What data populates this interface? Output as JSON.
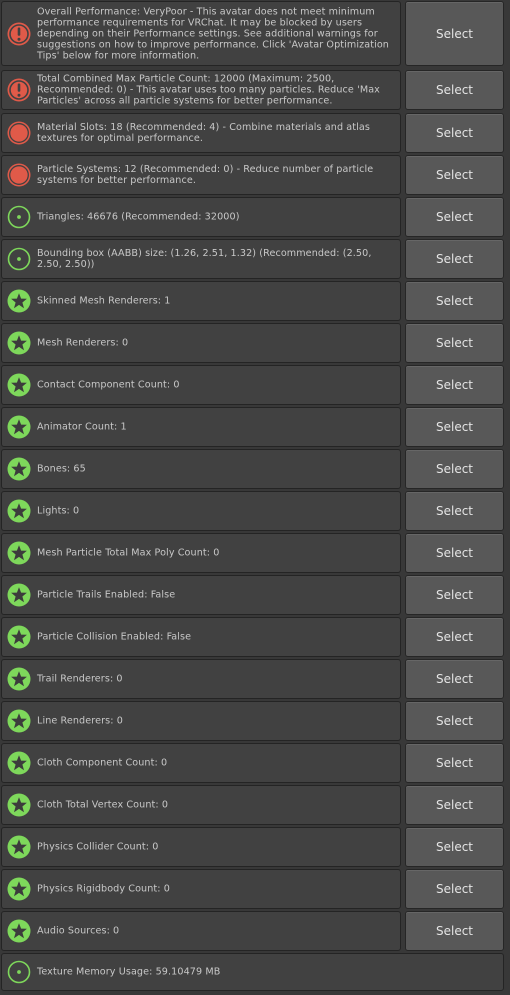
{
  "button_label": "Select",
  "colors": {
    "error": "#e05a49",
    "good": "#7ed85b",
    "info": "#7ed85b",
    "panel": "#414141",
    "button": "#585858",
    "background": "#383838"
  },
  "rows": [
    {
      "icon": "error-exclamation-icon",
      "status": "error",
      "text": "Overall Performance: VeryPoor - This avatar does not meet minimum performance requirements for VRChat. It may be blocked by users depending on their Performance settings. See additional warnings for suggestions on how to improve performance. Click 'Avatar Optimization Tips' below for more information.",
      "select": true
    },
    {
      "icon": "error-exclamation-icon",
      "status": "error",
      "text": "Total Combined Max Particle Count: 12000 (Maximum: 2500, Recommended: 0) - This avatar uses too many particles. Reduce 'Max Particles' across all particle systems for better performance.",
      "select": true
    },
    {
      "icon": "error-circle-icon",
      "status": "error",
      "text": "Material Slots: 18 (Recommended: 4) - Combine materials and atlas textures for optimal performance.",
      "select": true
    },
    {
      "icon": "error-circle-icon",
      "status": "error",
      "text": "Particle Systems: 12 (Recommended: 0) - Reduce number of particle systems for better performance.",
      "select": true
    },
    {
      "icon": "info-dot-icon",
      "status": "info",
      "text": "Triangles: 46676 (Recommended: 32000)",
      "select": true
    },
    {
      "icon": "info-dot-icon",
      "status": "info",
      "text": "Bounding box (AABB) size: (1.26, 2.51, 1.32) (Recommended: (2.50, 2.50, 2.50))",
      "select": true
    },
    {
      "icon": "star-icon",
      "status": "good",
      "text": "Skinned Mesh Renderers: 1",
      "select": true
    },
    {
      "icon": "star-icon",
      "status": "good",
      "text": "Mesh Renderers: 0",
      "select": true
    },
    {
      "icon": "star-icon",
      "status": "good",
      "text": "Contact Component Count: 0",
      "select": true
    },
    {
      "icon": "star-icon",
      "status": "good",
      "text": "Animator Count: 1",
      "select": true
    },
    {
      "icon": "star-icon",
      "status": "good",
      "text": "Bones: 65",
      "select": true
    },
    {
      "icon": "star-icon",
      "status": "good",
      "text": "Lights: 0",
      "select": true
    },
    {
      "icon": "star-icon",
      "status": "good",
      "text": "Mesh Particle Total Max Poly Count: 0",
      "select": true
    },
    {
      "icon": "star-icon",
      "status": "good",
      "text": "Particle Trails Enabled: False",
      "select": true
    },
    {
      "icon": "star-icon",
      "status": "good",
      "text": "Particle Collision Enabled: False",
      "select": true
    },
    {
      "icon": "star-icon",
      "status": "good",
      "text": "Trail Renderers: 0",
      "select": true
    },
    {
      "icon": "star-icon",
      "status": "good",
      "text": "Line Renderers: 0",
      "select": true
    },
    {
      "icon": "star-icon",
      "status": "good",
      "text": "Cloth Component Count: 0",
      "select": true
    },
    {
      "icon": "star-icon",
      "status": "good",
      "text": "Cloth Total Vertex Count: 0",
      "select": true
    },
    {
      "icon": "star-icon",
      "status": "good",
      "text": "Physics Collider Count: 0",
      "select": true
    },
    {
      "icon": "star-icon",
      "status": "good",
      "text": "Physics Rigidbody Count: 0",
      "select": true
    },
    {
      "icon": "star-icon",
      "status": "good",
      "text": "Audio Sources: 0",
      "select": true
    },
    {
      "icon": "info-dot-icon",
      "status": "info",
      "text": "Texture Memory Usage: 59.10479 MB",
      "select": false
    }
  ]
}
